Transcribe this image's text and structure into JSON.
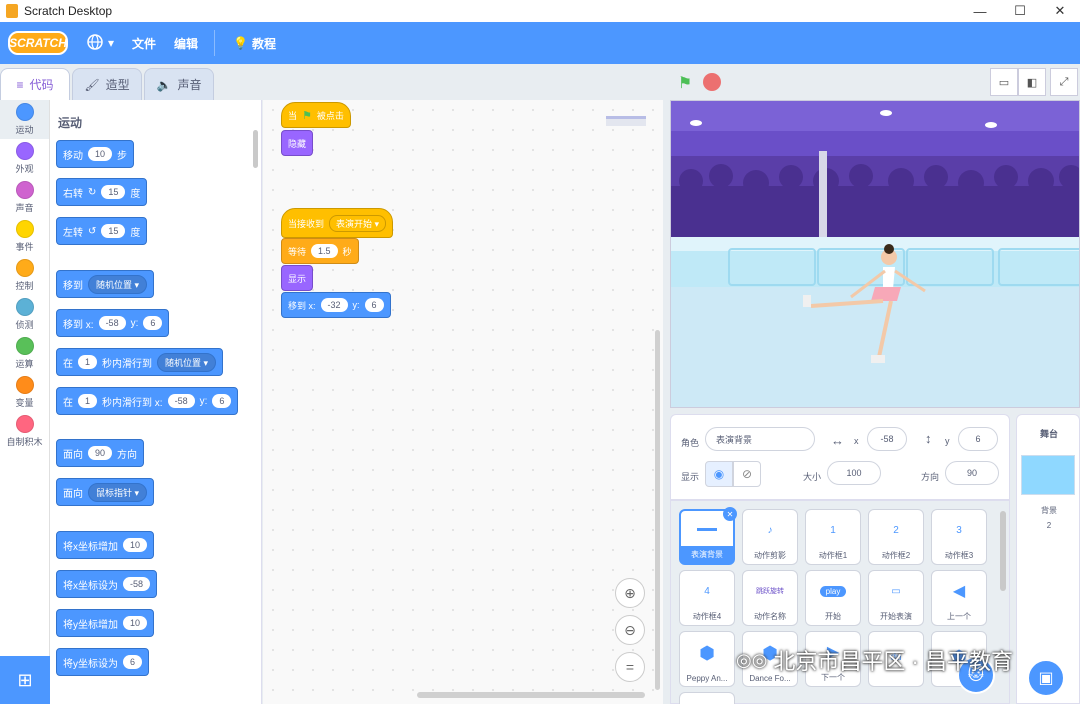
{
  "window": {
    "title": "Scratch Desktop",
    "controls": [
      "—",
      "☐",
      "✕"
    ]
  },
  "menu": {
    "logo": "SCRATCH",
    "file": "文件",
    "edit": "编辑",
    "tutorial": "教程"
  },
  "tabs": [
    {
      "label": "代码",
      "icon": "code-icon"
    },
    {
      "label": "造型",
      "icon": "brush-icon"
    },
    {
      "label": "声音",
      "icon": "speaker-icon"
    }
  ],
  "categories": [
    {
      "label": "运动",
      "color": "#4c97ff"
    },
    {
      "label": "外观",
      "color": "#9966ff"
    },
    {
      "label": "声音",
      "color": "#cf63cf"
    },
    {
      "label": "事件",
      "color": "#ffd500"
    },
    {
      "label": "控制",
      "color": "#ffab19"
    },
    {
      "label": "侦测",
      "color": "#5cb1d6"
    },
    {
      "label": "运算",
      "color": "#59c059"
    },
    {
      "label": "变量",
      "color": "#ff8c1a"
    },
    {
      "label": "自制积木",
      "color": "#ff6680"
    }
  ],
  "palette": {
    "section_title": "运动",
    "move": {
      "pre": "移动",
      "val": "10",
      "post": "步"
    },
    "turn_right": {
      "pre": "右转",
      "val": "15",
      "post": "度"
    },
    "turn_left": {
      "pre": "左转",
      "val": "15",
      "post": "度"
    },
    "goto": {
      "pre": "移到",
      "drop": "随机位置"
    },
    "goto_xy": {
      "pre": "移到 x:",
      "x": "-58",
      "ylabel": "y:",
      "y": "6"
    },
    "glide_to": {
      "pre": "在",
      "val": "1",
      "mid": "秒内滑行到",
      "drop": "随机位置"
    },
    "glide_xy": {
      "pre": "在",
      "val": "1",
      "mid": "秒内滑行到 x:",
      "x": "-58",
      "ylabel": "y:",
      "y": "6"
    },
    "point_dir": {
      "pre": "面向",
      "val": "90",
      "post": "方向"
    },
    "point_towards": {
      "pre": "面向",
      "drop": "鼠标指针"
    },
    "change_x": {
      "pre": "将x坐标增加",
      "val": "10"
    },
    "set_x": {
      "pre": "将x坐标设为",
      "val": "-58"
    },
    "change_y": {
      "pre": "将y坐标增加",
      "val": "10"
    },
    "set_y": {
      "pre": "将y坐标设为",
      "val": "6"
    }
  },
  "script": {
    "when_flag": {
      "pre": "当",
      "post": "被点击"
    },
    "hide": "隐藏",
    "when_receive": {
      "pre": "当接收到",
      "drop": "表演开始"
    },
    "wait": {
      "pre": "等待",
      "val": "1.5",
      "post": "秒"
    },
    "show": "显示",
    "goto_xy": {
      "pre": "移到 x:",
      "x": "-32",
      "ylabel": "y:",
      "y": "6"
    }
  },
  "sprite_info": {
    "sprite_label": "角色",
    "sprite_name": "表演背景",
    "x_label": "x",
    "x": "-58",
    "y_label": "y",
    "y": "6",
    "show_label": "显示",
    "size_label": "大小",
    "size": "100",
    "direction_label": "方向",
    "direction": "90"
  },
  "sprites": [
    {
      "name": "表演背景",
      "thumb": "▬▬",
      "selected": true
    },
    {
      "name": "动作剪影",
      "thumb": "♪"
    },
    {
      "name": "动作框1",
      "thumb": "1"
    },
    {
      "name": "动作框2",
      "thumb": "2"
    },
    {
      "name": "动作框3",
      "thumb": "3"
    },
    {
      "name": "动作框4",
      "thumb": "4"
    },
    {
      "name": "动作名称",
      "thumb": "跳跃旋转"
    },
    {
      "name": "开始",
      "thumb": "play"
    },
    {
      "name": "开始表演",
      "thumb": "▭"
    },
    {
      "name": "上一个",
      "thumb": "◀"
    },
    {
      "name": "Peppy An...",
      "thumb": "⬢"
    },
    {
      "name": "Dance Fo...",
      "thumb": "⬢"
    },
    {
      "name": "下一个",
      "thumb": "▶"
    },
    {
      "name": "",
      "thumb": "du"
    },
    {
      "name": "",
      "thumb": "⬢"
    }
  ],
  "stage_panel": {
    "title": "舞台",
    "bg_label": "背景",
    "bg_count": "2"
  },
  "watermark": "北京市昌平区 · 昌平教育",
  "colors": {
    "accent": "#4c97ff",
    "motion": "#4c97ff",
    "looks": "#9966ff",
    "events": "#ffbf00",
    "control": "#ffab19"
  }
}
